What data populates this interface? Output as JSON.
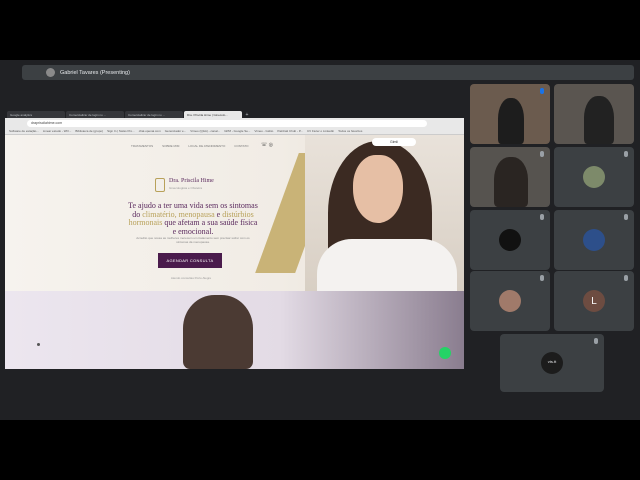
{
  "meet": {
    "presenter_label": "Gabriel Tavares (Presenting)"
  },
  "browser": {
    "tabs": [
      "Google analytics",
      "Comercializar de login no ...",
      "Comercializar de login no ...",
      "Dra. Priscila Hime | Ginecolo..."
    ],
    "active_tab_index": 3,
    "url": "drapriscilahime.com",
    "bookmarks": [
      "Software de estação...",
      "Linear estudo - WO...",
      "Biblioteca de (grupo)",
      "Sign In | Swiss Pro...",
      "chat.openai.com",
      "Gerenciador e...",
      "Vimeo (Q&A) - canal...",
      "GPM - Google Se...",
      "Vimeo - Gsbio",
      "Painhati Chub - P...",
      "CV Fazer o Linkedin",
      "Todos os favoritos"
    ]
  },
  "site": {
    "nav": [
      "TRATAMENTOS",
      "SOBRE MIM",
      "LOCAL DE ATENDIMENTO",
      "CONTATO"
    ],
    "nav_icons": "☏ ◎",
    "logo_name": "Dra. Priscila Hime",
    "logo_sub": "Ginecologista e Obstetra",
    "headline_1": "Te ajudo a ter uma vida sem os sintomas do ",
    "headline_gold_1": "climatério, menopausa",
    "headline_2": " e ",
    "headline_gold_2": "distúrbios hormonais",
    "headline_3": " que afetam a sua saúde física e emocional.",
    "subtext": "Acredito que nossa as mulheres merecem um tratamento sem precisar sofrer com os sintomas da menopausa.",
    "cta_label": "AGENDAR CONSULTA",
    "subcta": "Atendo consultas Porto Alegre",
    "badge": "Gimli"
  },
  "participants": [
    {
      "type": "camera"
    },
    {
      "type": "camera"
    },
    {
      "type": "camera"
    },
    {
      "type": "avatar"
    },
    {
      "type": "avatar-dark"
    },
    {
      "type": "avatar-group"
    },
    {
      "type": "avatar-person"
    },
    {
      "type": "letter",
      "letter": "L"
    },
    {
      "type": "logo",
      "label": "vts.tt"
    }
  ],
  "colors": {
    "brand_purple": "#4a1b4c",
    "gold": "#b8a15a",
    "meet_bg": "#202124",
    "tile_bg": "#3c4043",
    "whatsapp": "#25d366"
  }
}
